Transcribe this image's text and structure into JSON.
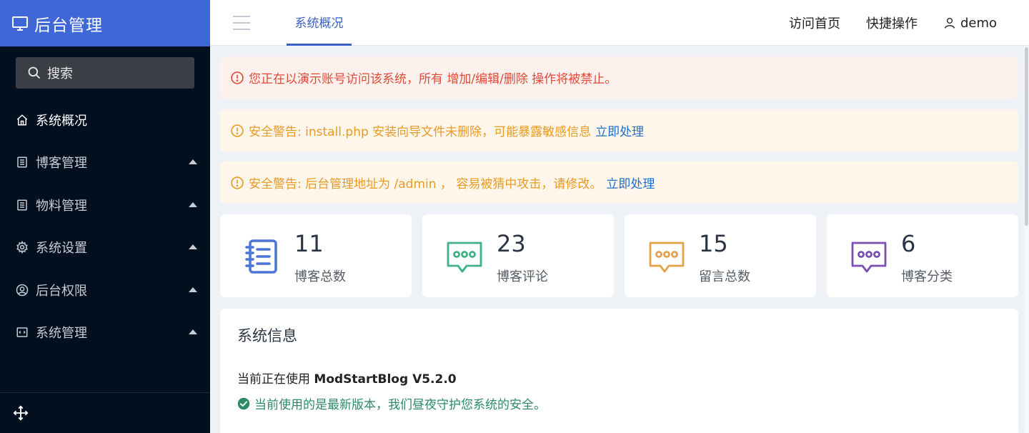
{
  "brand": {
    "title": "后台管理",
    "icon": "monitor-icon"
  },
  "search": {
    "label": "搜索",
    "icon": "search-icon"
  },
  "sidebar": {
    "items": [
      {
        "label": "系统概况",
        "icon": "home-icon",
        "active": true
      },
      {
        "label": "博客管理",
        "icon": "list-icon"
      },
      {
        "label": "物料管理",
        "icon": "list-icon"
      },
      {
        "label": "系统设置",
        "icon": "gear-icon"
      },
      {
        "label": "后台权限",
        "icon": "user-circle-icon"
      },
      {
        "label": "系统管理",
        "icon": "code-window-icon"
      }
    ],
    "footer_icon": "move-arrows-icon"
  },
  "topbar": {
    "active_tab": "系统概况",
    "links": {
      "home": "访问首页",
      "quick": "快捷操作",
      "user": "demo"
    }
  },
  "alerts": {
    "demo": "您正在以演示账号访问该系统，所有 增加/编辑/删除 操作将被禁止。",
    "install": {
      "text": "安全警告: install.php 安装向导文件未删除，可能暴露敏感信息",
      "action": "立即处理"
    },
    "admin_path": {
      "text": "安全警告: 后台管理地址为 /admin ， 容易被猜中攻击，请修改。",
      "action": "立即处理"
    }
  },
  "stats": [
    {
      "value": "11",
      "label": "博客总数",
      "icon": "notebook-icon",
      "color": "#4a74d6"
    },
    {
      "value": "23",
      "label": "博客评论",
      "icon": "comment-icon",
      "color": "#3fb387"
    },
    {
      "value": "15",
      "label": "留言总数",
      "icon": "comment-icon",
      "color": "#e3a24a"
    },
    {
      "value": "6",
      "label": "博客分类",
      "icon": "comment-icon",
      "color": "#7a4fb0"
    }
  ],
  "system_info": {
    "title": "系统信息",
    "using_prefix": "当前正在使用",
    "version": "ModStartBlog V5.2.0",
    "status": "当前使用的是最新版本，我们昼夜守护您系统的安全。"
  },
  "colors": {
    "accent": "#3f67d8",
    "sidebar_bg": "#020f1f",
    "danger": "#e04a37",
    "warning": "#e99a22",
    "link": "#1f6ec9",
    "success": "#2d8a66"
  }
}
